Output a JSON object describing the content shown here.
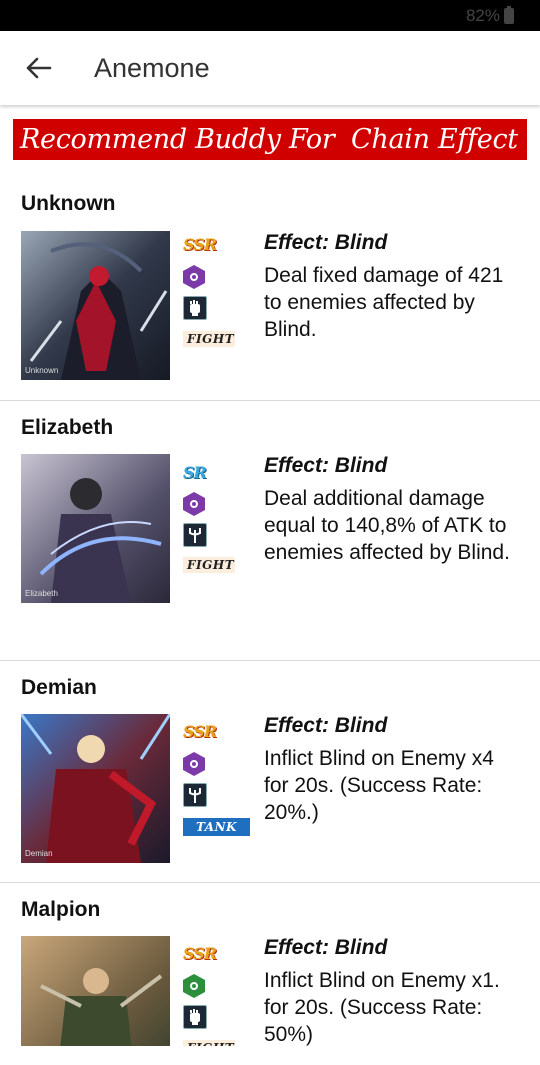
{
  "status": {
    "battery": "82%"
  },
  "appbar": {
    "title": "Anemone",
    "back_icon": "arrow-left-icon"
  },
  "banner": {
    "text": "Recommend Buddy For  Chain Effect"
  },
  "buddies": [
    {
      "name": "Unknown",
      "portrait_caption": "Unknown",
      "rarity": "SSR",
      "element": "dark",
      "class_icon": "fist-icon",
      "role": "FIGHT",
      "effect_title": "Effect: Blind",
      "effect_desc": "Deal fixed damage of 421 to enemies affected by Blind."
    },
    {
      "name": "Elizabeth",
      "portrait_caption": "Elizabeth",
      "rarity": "SR",
      "element": "dark",
      "class_icon": "trident-icon",
      "role": "FIGHT",
      "effect_title": "Effect: Blind",
      "effect_desc": "Deal additional damage equal to 140,8% of ATK to enemies affected by Blind."
    },
    {
      "name": "Demian",
      "portrait_caption": "Demian",
      "rarity": "SSR",
      "element": "dark",
      "class_icon": "trident-icon",
      "role": "TANK",
      "effect_title": "Effect: Blind",
      "effect_desc": "Inflict Blind on Enemy x4 for 20s. (Success Rate: 20%.)"
    },
    {
      "name": "Malpion",
      "portrait_caption": "",
      "rarity": "SSR",
      "element": "wind",
      "class_icon": "fist-icon",
      "role": "FIGHT",
      "effect_title": "Effect: Blind",
      "effect_desc": "Inflict Blind on Enemy x1. for 20s. (Success Rate: 50%)"
    }
  ],
  "colors": {
    "banner_bg": "#d10000",
    "ssr": "#e7a41a",
    "sr": "#3aa8dd",
    "dark": "#7b3aa8",
    "wind": "#2c8f3b"
  }
}
